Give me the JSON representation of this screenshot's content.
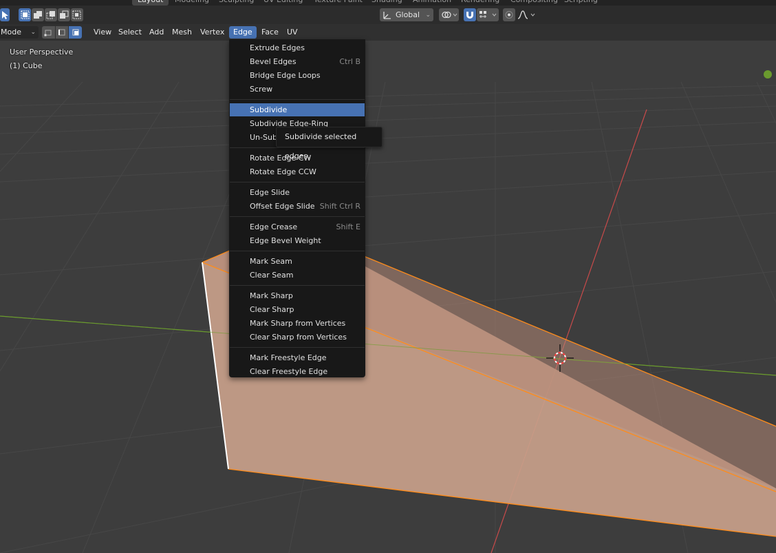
{
  "workspaces": [
    "Layout",
    "Modeling",
    "Sculpting",
    "UV Editing",
    "Texture Paint",
    "Shading",
    "Animation",
    "Rendering",
    "Compositing",
    "Scripting"
  ],
  "active_workspace": "Layout",
  "header": {
    "transform_orientation": "Global"
  },
  "editor_header": {
    "mode": "Mode",
    "menus": [
      "View",
      "Select",
      "Add",
      "Mesh",
      "Vertex",
      "Edge",
      "Face",
      "UV"
    ],
    "open_menu": "Edge"
  },
  "viewport": {
    "perspective": "User Perspective",
    "object": "(1) Cube"
  },
  "edge_menu": {
    "groups": [
      [
        {
          "label": "Extrude Edges",
          "shortcut": ""
        },
        {
          "label": "Bevel Edges",
          "shortcut": "Ctrl B"
        },
        {
          "label": "Bridge Edge Loops",
          "shortcut": ""
        },
        {
          "label": "Screw",
          "shortcut": ""
        }
      ],
      [
        {
          "label": "Subdivide",
          "shortcut": "",
          "highlighted": true
        },
        {
          "label": "Subdivide Edge-Ring",
          "shortcut": ""
        },
        {
          "label": "Un-Subdivide",
          "shortcut": ""
        }
      ],
      [
        {
          "label": "Rotate Edge CW",
          "shortcut": ""
        },
        {
          "label": "Rotate Edge CCW",
          "shortcut": ""
        }
      ],
      [
        {
          "label": "Edge Slide",
          "shortcut": ""
        },
        {
          "label": "Offset Edge Slide",
          "shortcut": "Shift Ctrl R"
        }
      ],
      [
        {
          "label": "Edge Crease",
          "shortcut": "Shift E"
        },
        {
          "label": "Edge Bevel Weight",
          "shortcut": ""
        }
      ],
      [
        {
          "label": "Mark Seam",
          "shortcut": ""
        },
        {
          "label": "Clear Seam",
          "shortcut": ""
        }
      ],
      [
        {
          "label": "Mark Sharp",
          "shortcut": ""
        },
        {
          "label": "Clear Sharp",
          "shortcut": ""
        },
        {
          "label": "Mark Sharp from Vertices",
          "shortcut": ""
        },
        {
          "label": "Clear Sharp from Vertices",
          "shortcut": ""
        }
      ],
      [
        {
          "label": "Mark Freestyle Edge",
          "shortcut": ""
        },
        {
          "label": "Clear Freestyle Edge",
          "shortcut": ""
        }
      ]
    ]
  },
  "tooltip": "Subdivide selected edges.",
  "colors": {
    "highlight": "#4772b3",
    "mesh_face": "#c8a08a",
    "mesh_edge": "#ff8c1a",
    "x_axis": "#c84a4a",
    "y_axis": "#6a9a2e"
  }
}
